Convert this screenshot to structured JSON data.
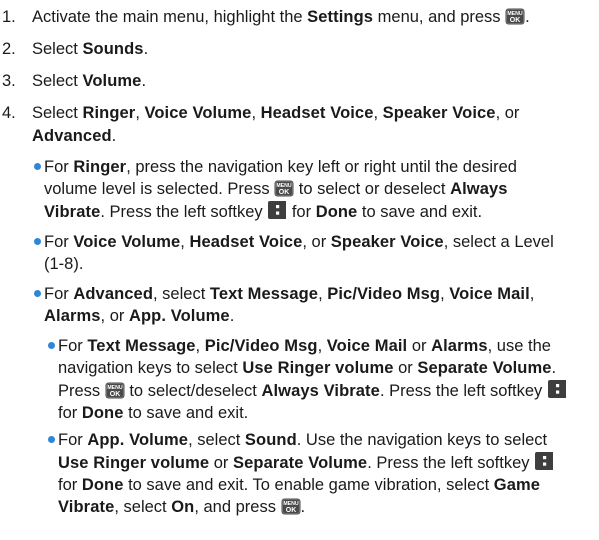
{
  "icons": {
    "menu_ok": {
      "name": "menu-ok-key-icon",
      "top": "MENU",
      "bottom": "OK"
    },
    "left_softkey": {
      "name": "left-softkey-icon"
    }
  },
  "steps": [
    {
      "num": "1.",
      "t1": "Activate the main menu, highlight the ",
      "b1": "Settings",
      "t2": " menu, and press ",
      "t3": "."
    },
    {
      "num": "2.",
      "t1": "Select ",
      "b1": "Sounds",
      "t2": "."
    },
    {
      "num": "3.",
      "t1": "Select ",
      "b1": "Volume",
      "t2": "."
    },
    {
      "num": "4.",
      "t1": "Select ",
      "b1": "Ringer",
      "t2": ", ",
      "b2": "Voice Volume",
      "t3": ", ",
      "b3": "Headset Voice",
      "t4": ", ",
      "b4": "Speaker Voice",
      "t5": ", or",
      "b5": "Advanced",
      "t6": "."
    }
  ],
  "bullets": {
    "ringer": {
      "t1": "For ",
      "b1": "Ringer",
      "t2": ", press the navigation key left or right until the desired volume level is selected. Press ",
      "t3": " to select or deselect ",
      "b2": "Always Vibrate",
      "t4": ". Press the left softkey ",
      "t5": " for ",
      "b3": "Done",
      "t6": " to save and exit."
    },
    "voice": {
      "t1": "For ",
      "b1": "Voice Volume",
      "t2": ", ",
      "b2": "Headset Voice",
      "t3": ", or ",
      "b3": "Speaker Voice",
      "t4": ", select a Level (1-8)."
    },
    "advanced": {
      "t1": "For ",
      "b1": "Advanced",
      "t2": ", select ",
      "b2": "Text Message",
      "t3": ", ",
      "b3": "Pic/Video Msg",
      "t4": ", ",
      "b4": "Voice Mail",
      "t5": ", ",
      "b5": "Alarms",
      "t6": ", or ",
      "b6": "App. Volume",
      "t7": "."
    },
    "text_msg": {
      "t1": "For ",
      "b1": "Text Message",
      "t2": ", ",
      "b2": "Pic/Video Msg",
      "t3": ", ",
      "b3": "Voice Mail",
      "t4": " or ",
      "b4": "Alarms",
      "t5": ", use the navigation keys to select ",
      "b5": "Use Ringer volume",
      "t6": " or ",
      "b6": "Separate Volume",
      "t7": ". Press ",
      "t8": " to select/deselect ",
      "b7": "Always Vibrate",
      "t9": ". Press the left softkey ",
      "t10": " for ",
      "b8": "Done",
      "t11": " to save and exit."
    },
    "app_volume": {
      "t1": "For ",
      "b1": "App. Volume",
      "t2": ", select ",
      "b2": "Sound",
      "t3": ". Use the navigation keys to select ",
      "b3": "Use Ringer volume",
      "t4": " or ",
      "b4": "Separate Volume",
      "t5": ". Press the left softkey ",
      "t6": " for ",
      "b5": "Done",
      "t7": " to save and exit. To enable game vibration, select ",
      "b6": "Game Vibrate",
      "t8": ", select ",
      "b7": "On",
      "t9": ", and press ",
      "t10": "."
    }
  }
}
